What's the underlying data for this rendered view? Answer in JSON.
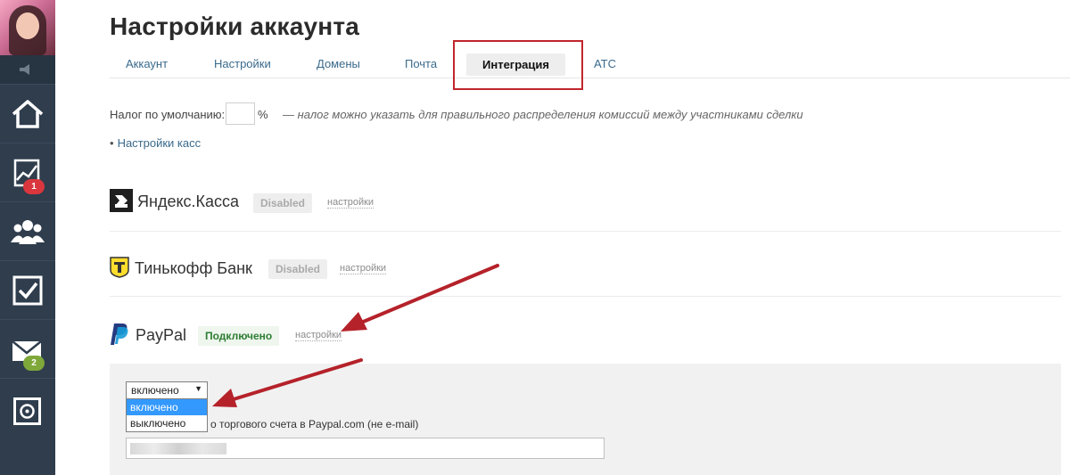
{
  "page": {
    "title": "Настройки аккаунта"
  },
  "tabs": [
    {
      "label": "Аккаунт",
      "active": false
    },
    {
      "label": "Настройки",
      "active": false
    },
    {
      "label": "Домены",
      "active": false
    },
    {
      "label": "Почта",
      "active": false
    },
    {
      "label": "Интеграция",
      "active": true
    },
    {
      "label": "АТС",
      "active": false
    }
  ],
  "sidebar": {
    "items": [
      {
        "icon": "home-icon",
        "badge": ""
      },
      {
        "icon": "chart-icon",
        "badge": "1",
        "badge_color": "#d9363e"
      },
      {
        "icon": "users-icon",
        "badge": ""
      },
      {
        "icon": "checkbox-icon",
        "badge": ""
      },
      {
        "icon": "mail-icon",
        "badge": "2",
        "badge_color": "#7fa83a"
      },
      {
        "icon": "safe-icon",
        "badge": ""
      }
    ]
  },
  "tax": {
    "label": "Налог по умолчанию:",
    "value": "",
    "percent": "%",
    "hint": "— налог можно указать для правильного распределения комиссий между участниками сделки"
  },
  "kassa_link": {
    "bullet": "•",
    "label": "Настройки касс"
  },
  "integrations": [
    {
      "name": "Яндекс.Касса",
      "status": "Disabled",
      "settings": "настройки"
    },
    {
      "name": "Тинькофф Банк",
      "status": "Disabled",
      "settings": "настройки"
    },
    {
      "name": "PayPal",
      "status": "Подключено",
      "settings": "настройки"
    }
  ],
  "paypal_panel": {
    "select_value": "включено",
    "options": [
      "включено",
      "выключено"
    ],
    "merchant_label": "о торгового счета в Paypal.com (не e-mail)",
    "merchant_value": ""
  },
  "colors": {
    "sidebar": "#2f3d4d",
    "link": "#3a6a8c",
    "annotation": "#c0262c",
    "connected": "#2e7d32"
  }
}
